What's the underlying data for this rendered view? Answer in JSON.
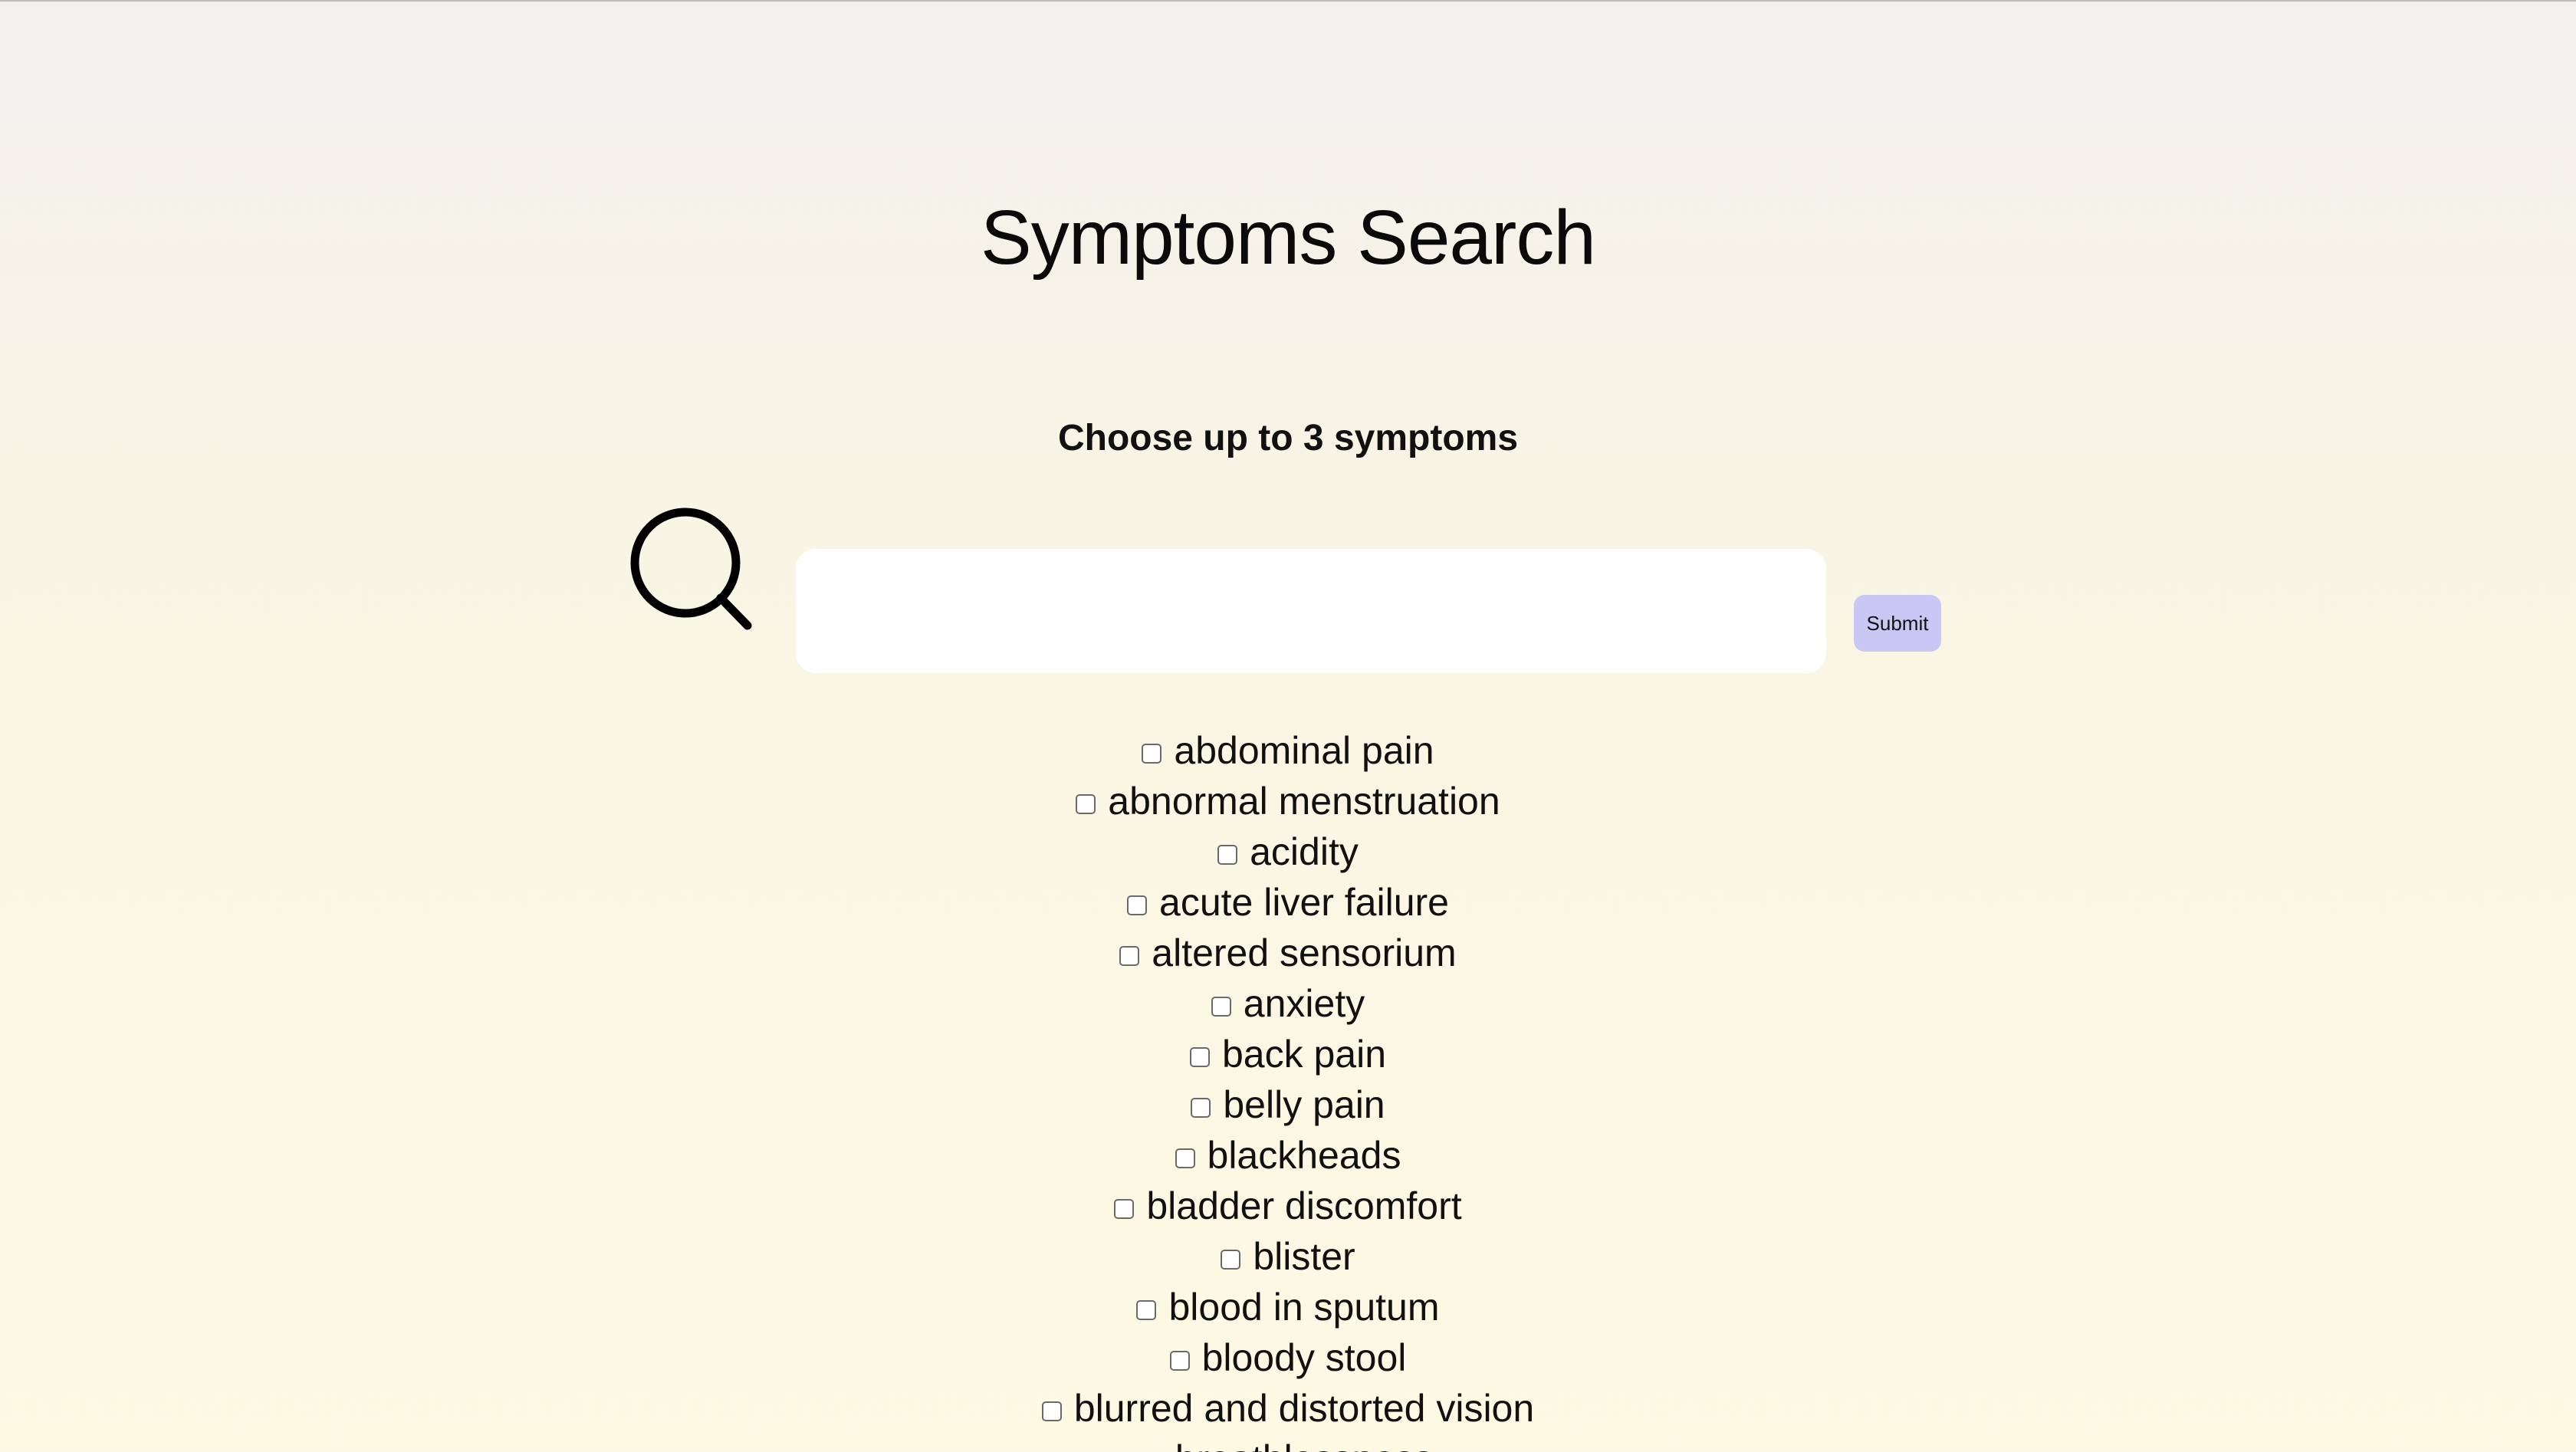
{
  "header": {
    "title": "Symptoms Search",
    "subtitle": "Choose up to 3 symptoms"
  },
  "search": {
    "icon": "search-icon",
    "value": "",
    "placeholder": "",
    "submit_label": "Submit"
  },
  "colors": {
    "submit_bg": "#c9c7f4",
    "input_bg": "#ffffff"
  },
  "symptoms": [
    {
      "label": "abdominal pain",
      "checked": false
    },
    {
      "label": "abnormal menstruation",
      "checked": false
    },
    {
      "label": "acidity",
      "checked": false
    },
    {
      "label": "acute liver failure",
      "checked": false
    },
    {
      "label": "altered sensorium",
      "checked": false
    },
    {
      "label": "anxiety",
      "checked": false
    },
    {
      "label": "back pain",
      "checked": false
    },
    {
      "label": "belly pain",
      "checked": false
    },
    {
      "label": "blackheads",
      "checked": false
    },
    {
      "label": "bladder discomfort",
      "checked": false
    },
    {
      "label": "blister",
      "checked": false
    },
    {
      "label": "blood in sputum",
      "checked": false
    },
    {
      "label": "bloody stool",
      "checked": false
    },
    {
      "label": "blurred and distorted vision",
      "checked": false
    },
    {
      "label": "breathlessness",
      "checked": false
    }
  ]
}
